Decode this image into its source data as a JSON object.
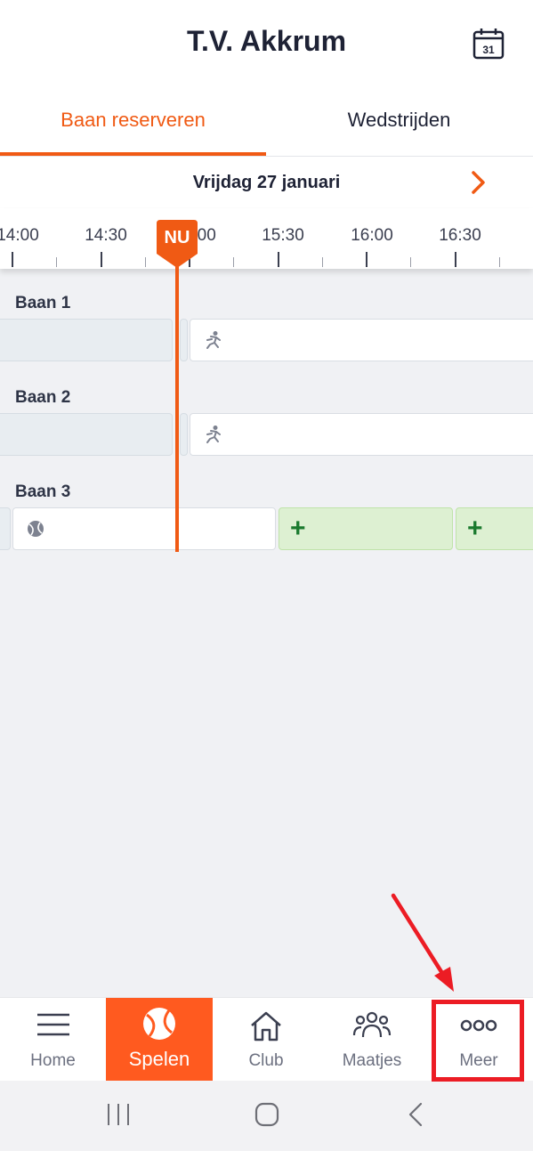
{
  "header": {
    "title": "T.V. Akkrum",
    "calendar_icon": "calendar-icon",
    "calendar_day": "31"
  },
  "tabs": [
    {
      "label": "Baan reserveren",
      "active": true
    },
    {
      "label": "Wedstrijden",
      "active": false
    }
  ],
  "date_bar": {
    "date": "Vrijdag 27 januari",
    "next_icon": "chevron-right-icon"
  },
  "timeline": {
    "labels": [
      "14:00",
      "14:30",
      "15:00",
      "15:30",
      "16:00",
      "16:30"
    ],
    "now_label": "NU"
  },
  "courts": [
    {
      "name": "Baan 1",
      "slots": [
        "past",
        "booked-player"
      ]
    },
    {
      "name": "Baan 2",
      "slots": [
        "past",
        "booked-player"
      ]
    },
    {
      "name": "Baan 3",
      "slots": [
        "past",
        "booked-ball",
        "free",
        "free"
      ]
    }
  ],
  "bottom_nav": [
    {
      "label": "Home",
      "icon": "menu-icon",
      "active": false
    },
    {
      "label": "Spelen",
      "icon": "tennis-ball-icon",
      "active": true
    },
    {
      "label": "Club",
      "icon": "home-icon",
      "active": false
    },
    {
      "label": "Maatjes",
      "icon": "group-icon",
      "active": false
    },
    {
      "label": "Meer",
      "icon": "more-icon",
      "active": false
    }
  ],
  "colors": {
    "accent": "#f05a14",
    "nav_active": "#ff5a1f",
    "free_slot": "#ddf0d2",
    "annotation": "#ec1c24"
  }
}
